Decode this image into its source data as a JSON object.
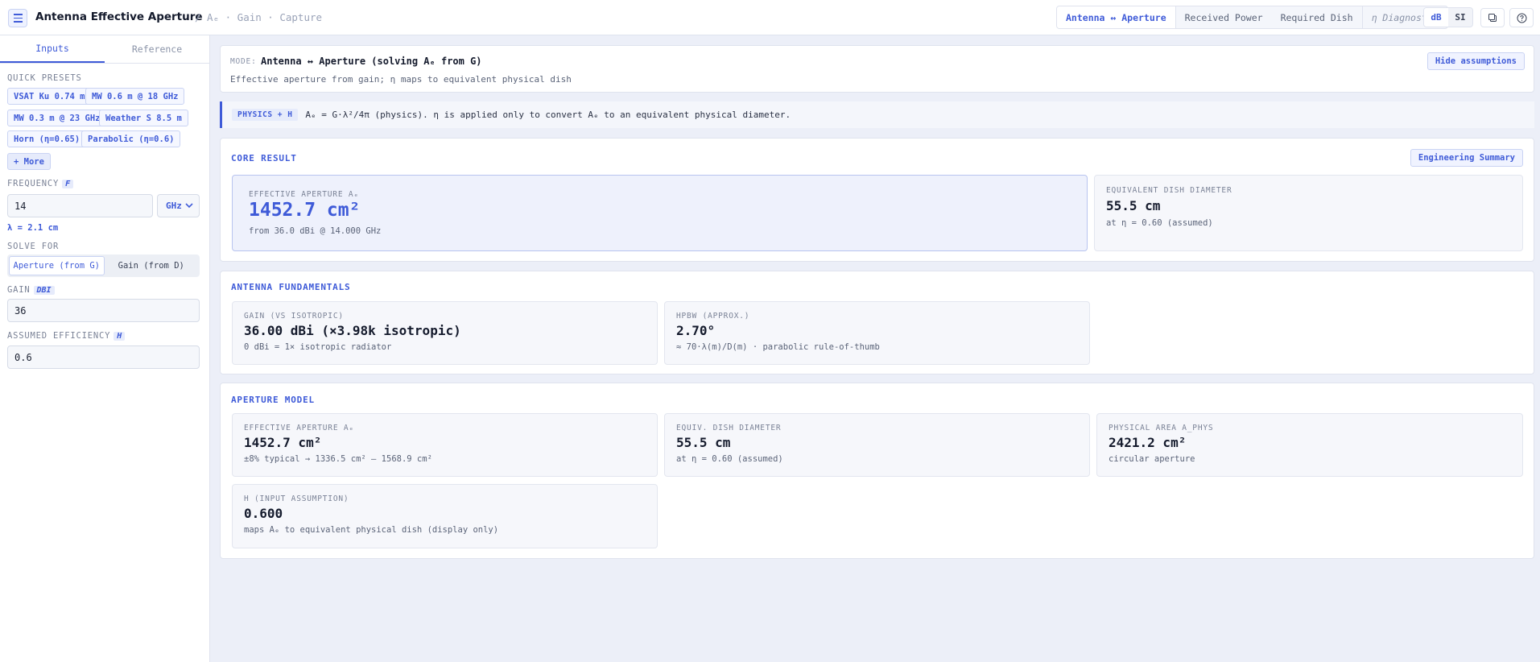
{
  "header": {
    "title": "Antenna Effective Aperture",
    "breadcrumb": "/ Aₑ · Gain · Capture",
    "mode_tabs": [
      "Antenna ↔ Aperture",
      "Received Power",
      "Required Dish",
      "η Diagnostic"
    ],
    "unit_toggle": [
      "dB",
      "SI"
    ],
    "active_unit": "dB"
  },
  "sidebar": {
    "tabs": [
      "Inputs",
      "Reference"
    ],
    "quick_presets_label": "QUICK PRESETS",
    "presets": [
      "VSAT Ku 0.74 m",
      "MW 0.6 m @ 18 GHz",
      "MW 0.3 m @ 23 GHz",
      "Weather S 8.5 m",
      "Horn (η=0.65)",
      "Parabolic (η=0.6)",
      "+ More"
    ],
    "frequency_label": "FREQUENCY",
    "frequency_symbol": "F",
    "frequency_value": "14",
    "frequency_unit": "GHz",
    "lambda_text": "λ = 2.1 cm",
    "solve_for_label": "SOLVE FOR",
    "solve_options": [
      "Aperture (from G)",
      "Gain (from D)"
    ],
    "gain_label": "GAIN",
    "gain_symbol": "DBI",
    "gain_value": "36",
    "efficiency_label": "ASSUMED EFFICIENCY",
    "efficiency_symbol": "H",
    "efficiency_value": "0.6"
  },
  "mode_card": {
    "label": "MODE:",
    "title": "Antenna ↔ Aperture (solving Aₑ from G)",
    "subtitle": "Effective aperture from gain; η maps to equivalent physical dish",
    "button": "Hide assumptions"
  },
  "formula": {
    "tag": "PHYSICS + H",
    "text": "Aₑ = G·λ²/4π (physics). η is applied only to convert Aₑ to an equivalent physical diameter."
  },
  "core_result": {
    "title": "CORE RESULT",
    "button": "Engineering Summary",
    "primary": {
      "label": "EFFECTIVE APERTURE Aₑ",
      "value": "1452.7 cm²",
      "sub": "from 36.0 dBi @ 14.000 GHz"
    },
    "secondary": {
      "label": "EQUIVALENT DISH DIAMETER",
      "value": "55.5 cm",
      "sub": "at η = 0.60 (assumed)"
    }
  },
  "fundamentals": {
    "title": "ANTENNA FUNDAMENTALS",
    "tiles": [
      {
        "label": "GAIN (VS ISOTROPIC)",
        "value": "36.00 dBi (×3.98k isotropic)",
        "sub": "0 dBi = 1× isotropic radiator"
      },
      {
        "label": "HPBW (APPROX.)",
        "value": "2.70°",
        "sub": "≈ 70·λ(m)/D(m) · parabolic rule-of-thumb"
      }
    ]
  },
  "aperture_model": {
    "title": "APERTURE MODEL",
    "tiles": [
      {
        "label": "EFFECTIVE APERTURE Aₑ",
        "value": "1452.7 cm²",
        "sub": "±8% typical → 1336.5 cm² – 1568.9 cm²"
      },
      {
        "label": "EQUIV. DISH DIAMETER",
        "value": "55.5 cm",
        "sub": "at η = 0.60 (assumed)"
      },
      {
        "label": "PHYSICAL AREA A_PHYS",
        "value": "2421.2 cm²",
        "sub": "circular aperture"
      },
      {
        "label": "H (INPUT ASSUMPTION)",
        "value": "0.600",
        "sub": "maps Aₑ to equivalent physical dish (display only)"
      }
    ]
  },
  "colors": {
    "accent": "#3f5bd8",
    "background": "#eceff8"
  }
}
